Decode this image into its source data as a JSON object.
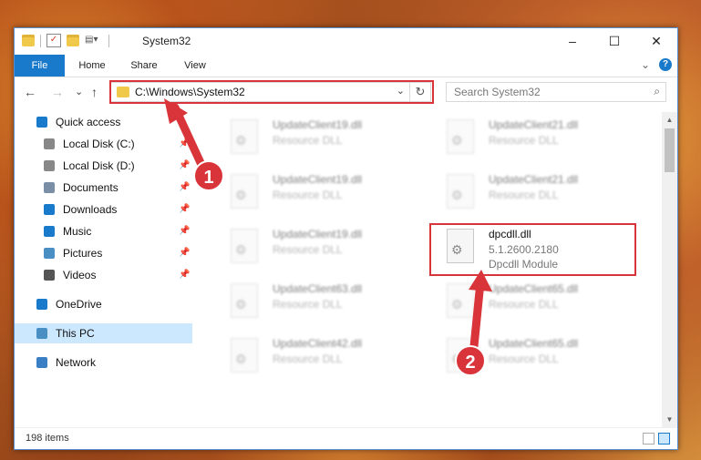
{
  "window": {
    "title": "System32",
    "minimize": "–",
    "maximize": "☐",
    "close": "✕"
  },
  "ribbon": {
    "tabs": [
      "File",
      "Home",
      "Share",
      "View"
    ],
    "expand": "⌄",
    "help": "?"
  },
  "nav": {
    "back": "←",
    "forward": "→",
    "recent": "⌄",
    "up": "↑",
    "address": "C:\\Windows\\System32",
    "search_placeholder": "Search System32"
  },
  "sidebar": {
    "items": [
      {
        "label": "Quick access",
        "icon": "star-icon"
      },
      {
        "label": "Local Disk (C:)",
        "icon": "drive-icon",
        "pinned": true
      },
      {
        "label": "Local Disk (D:)",
        "icon": "drive-icon",
        "pinned": true
      },
      {
        "label": "Documents",
        "icon": "documents-icon",
        "pinned": true
      },
      {
        "label": "Downloads",
        "icon": "downloads-icon",
        "pinned": true
      },
      {
        "label": "Music",
        "icon": "music-icon",
        "pinned": true
      },
      {
        "label": "Pictures",
        "icon": "pictures-icon",
        "pinned": true
      },
      {
        "label": "Videos",
        "icon": "videos-icon",
        "pinned": true
      },
      {
        "label": "OneDrive",
        "icon": "cloud-icon"
      },
      {
        "label": "This PC",
        "icon": "computer-icon",
        "selected": true
      },
      {
        "label": "Network",
        "icon": "network-icon"
      }
    ]
  },
  "files": [
    {
      "name": "UpdateClient19.dll",
      "type": "Resource DLL"
    },
    {
      "name": "UpdateClient21.dll",
      "type": "Resource DLL"
    },
    {
      "name": "UpdateClient19.dll",
      "type": "Resource DLL"
    },
    {
      "name": "UpdateClient21.dll",
      "type": "Resource DLL"
    },
    {
      "name": "UpdateClient19.dll",
      "type": "Resource DLL"
    },
    {
      "name": "dpcdll.dll",
      "version": "5.1.2600.2180",
      "type": "Dpcdll Module",
      "highlighted": true
    },
    {
      "name": "UpdateClient63.dll",
      "type": "Resource DLL"
    },
    {
      "name": "UpdateClient65.dll",
      "type": "Resource DLL"
    },
    {
      "name": "UpdateClient42.dll",
      "type": "Resource DLL"
    },
    {
      "name": "UpdateClient65.dll",
      "type": "Resource DLL"
    }
  ],
  "status": {
    "item_count": "198 items"
  },
  "callouts": [
    "1",
    "2"
  ],
  "colors": {
    "accent": "#1979ca",
    "highlight_box": "#d9343a",
    "selected_nav": "#cce8ff"
  }
}
